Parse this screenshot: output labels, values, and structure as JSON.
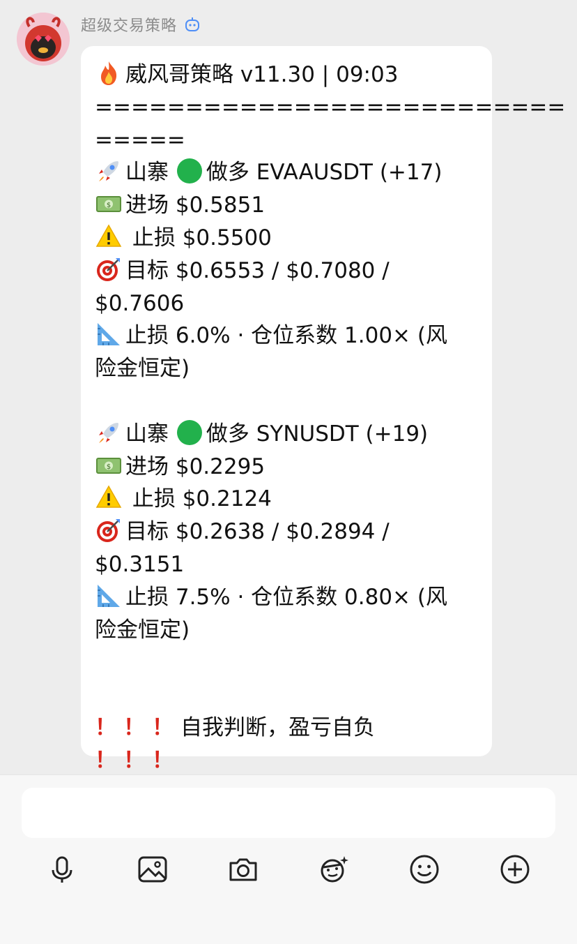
{
  "sender": {
    "name": "超级交易策略"
  },
  "message": {
    "header": "威风哥策略 v11.30 | 09:03",
    "separator_1": "==========================",
    "separator_2": "=====",
    "signals": [
      {
        "title": "山寨",
        "direction": "做多 EVAAUSDT (+17)",
        "entry": "进场 $0.5851",
        "stop": "止损 $0.5500",
        "target_1": "目标 $0.6553 / $0.7080 /",
        "target_2": "$0.7606",
        "risk_1": "止损 6.0% · 仓位系数 1.00× (风",
        "risk_2": "险金恒定)"
      },
      {
        "title": "山寨",
        "direction": "做多 SYNUSDT (+19)",
        "entry": "进场 $0.2295",
        "stop": "止损 $0.2124",
        "target_1": "目标 $0.2638 / $0.2894 /",
        "target_2": "$0.3151",
        "risk_1": "止损 7.5% · 仓位系数 0.80× (风",
        "risk_2": "险金恒定)"
      }
    ],
    "disclaimer": "自我判断，盈亏自负",
    "exclaim": "！！！"
  },
  "toolbar": {
    "icons": [
      "microphone-icon",
      "image-icon",
      "camera-icon",
      "ai-assistant-icon",
      "emoji-icon",
      "plus-icon"
    ]
  },
  "colors": {
    "bubble": "#ffffff",
    "background": "#ededed",
    "bar": "#f7f7f7",
    "alert": "#d9261c",
    "green": "#22b14c"
  }
}
